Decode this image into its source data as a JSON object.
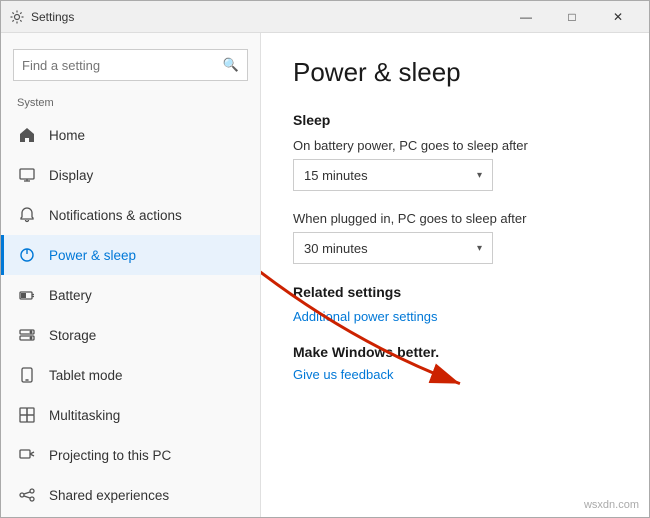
{
  "window": {
    "title": "Settings",
    "controls": {
      "minimize": "—",
      "maximize": "□",
      "close": "✕"
    }
  },
  "sidebar": {
    "search_placeholder": "Find a setting",
    "section_label": "System",
    "items": [
      {
        "id": "home",
        "label": "Home",
        "icon": "home"
      },
      {
        "id": "display",
        "label": "Display",
        "icon": "display"
      },
      {
        "id": "notifications",
        "label": "Notifications & actions",
        "icon": "notifications"
      },
      {
        "id": "power",
        "label": "Power & sleep",
        "icon": "power",
        "active": true
      },
      {
        "id": "battery",
        "label": "Battery",
        "icon": "battery"
      },
      {
        "id": "storage",
        "label": "Storage",
        "icon": "storage"
      },
      {
        "id": "tablet",
        "label": "Tablet mode",
        "icon": "tablet"
      },
      {
        "id": "multitasking",
        "label": "Multitasking",
        "icon": "multitasking"
      },
      {
        "id": "projecting",
        "label": "Projecting to this PC",
        "icon": "projecting"
      },
      {
        "id": "shared",
        "label": "Shared experiences",
        "icon": "shared"
      }
    ]
  },
  "main": {
    "page_title": "Power & sleep",
    "sleep_section": {
      "title": "Sleep",
      "battery_label": "On battery power, PC goes to sleep after",
      "battery_value": "15 minutes",
      "plugged_label": "When plugged in, PC goes to sleep after",
      "plugged_value": "30 minutes"
    },
    "related_settings": {
      "title": "Related settings",
      "link_label": "Additional power settings"
    },
    "make_windows": {
      "title": "Make Windows better.",
      "link_label": "Give us feedback"
    }
  },
  "watermark": "wsxdn.com"
}
